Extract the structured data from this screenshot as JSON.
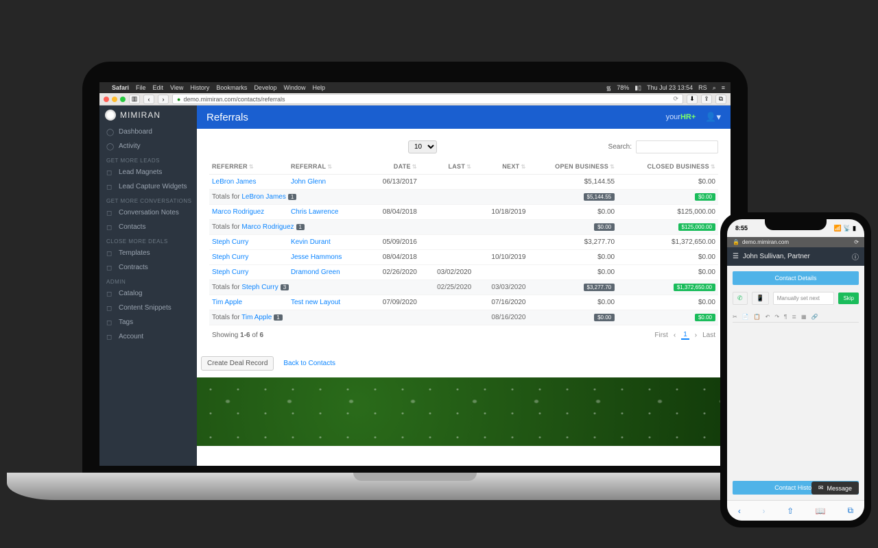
{
  "menubar": {
    "app": "Safari",
    "menus": [
      "File",
      "Edit",
      "View",
      "History",
      "Bookmarks",
      "Develop",
      "Window",
      "Help"
    ],
    "battery": "78%",
    "datetime": "Thu Jul 23 13:54",
    "user": "RS"
  },
  "browser": {
    "url": "demo.mimiran.com/contacts/referrals"
  },
  "brand": "MIMIRAN",
  "topbar_brand": {
    "prefix": "your",
    "accent": "HR+"
  },
  "sidebar": {
    "items_top": [
      {
        "label": "Dashboard",
        "icon": "speedometer-icon"
      },
      {
        "label": "Activity",
        "icon": "heart-icon"
      }
    ],
    "sections": [
      {
        "title": "GET MORE LEADS",
        "items": [
          {
            "label": "Lead Magnets",
            "icon": "magnet-icon"
          },
          {
            "label": "Lead Capture Widgets",
            "icon": "widget-icon"
          }
        ]
      },
      {
        "title": "GET MORE CONVERSATIONS",
        "items": [
          {
            "label": "Conversation Notes",
            "icon": "chat-icon"
          },
          {
            "label": "Contacts",
            "icon": "user-icon"
          }
        ]
      },
      {
        "title": "CLOSE MORE DEALS",
        "items": [
          {
            "label": "Templates",
            "icon": "template-icon"
          },
          {
            "label": "Contracts",
            "icon": "contract-icon"
          }
        ]
      },
      {
        "title": "ADMIN",
        "items": [
          {
            "label": "Catalog",
            "icon": "catalog-icon"
          },
          {
            "label": "Content Snippets",
            "icon": "snippet-icon"
          },
          {
            "label": "Tags",
            "icon": "tag-icon"
          },
          {
            "label": "Account",
            "icon": "account-icon"
          }
        ]
      }
    ]
  },
  "page": {
    "title": "Referrals",
    "page_size": "10",
    "search_label": "Search:",
    "search_value": "",
    "columns": [
      "REFERRER",
      "REFERRAL",
      "DATE",
      "LAST",
      "NEXT",
      "OPEN BUSINESS",
      "CLOSED BUSINESS"
    ],
    "entries": [
      {
        "type": "row",
        "referrer": "LeBron James",
        "referral": "John Glenn",
        "date": "06/13/2017",
        "last": "",
        "next": "",
        "open": "$5,144.55",
        "closed": "$0.00"
      },
      {
        "type": "totals",
        "label_prefix": "Totals for ",
        "name": "LeBron James",
        "count": "1",
        "open": "$5,144.55",
        "open_style": "dark",
        "closed": "$0.00",
        "closed_style": "grn"
      },
      {
        "type": "row",
        "referrer": "Marco Rodriguez",
        "referral": "Chris Lawrence",
        "date": "08/04/2018",
        "last": "",
        "next": "10/18/2019",
        "open": "$0.00",
        "closed": "$125,000.00"
      },
      {
        "type": "totals",
        "label_prefix": "Totals for ",
        "name": "Marco Rodriguez",
        "count": "1",
        "open": "$0.00",
        "open_style": "dark",
        "closed": "$125,000.00",
        "closed_style": "grn"
      },
      {
        "type": "row",
        "referrer": "Steph Curry",
        "referral": "Kevin Durant",
        "date": "05/09/2016",
        "last": "",
        "next": "",
        "open": "$3,277.70",
        "closed": "$1,372,650.00"
      },
      {
        "type": "row",
        "referrer": "Steph Curry",
        "referral": "Jesse Hammons",
        "date": "08/04/2018",
        "last": "",
        "next": "10/10/2019",
        "open": "$0.00",
        "closed": "$0.00"
      },
      {
        "type": "row",
        "referrer": "Steph Curry",
        "referral": "Dramond Green",
        "date": "02/26/2020",
        "last": "03/02/2020",
        "next": "",
        "open": "$0.00",
        "closed": "$0.00"
      },
      {
        "type": "totals",
        "label_prefix": "Totals for ",
        "name": "Steph Curry",
        "count": "3",
        "last": "02/25/2020",
        "next": "03/03/2020",
        "open": "$3,277.70",
        "open_style": "dark",
        "closed": "$1,372,650.00",
        "closed_style": "grn"
      },
      {
        "type": "row",
        "referrer": "Tim Apple",
        "referral": "Test new Layout",
        "date": "07/09/2020",
        "last": "",
        "next": "07/16/2020",
        "open": "$0.00",
        "closed": "$0.00"
      },
      {
        "type": "totals",
        "label_prefix": "Totals for ",
        "name": "Tim Apple",
        "count": "1",
        "next": "08/16/2020",
        "open": "$0.00",
        "open_style": "dark",
        "closed": "$0.00",
        "closed_style": "grn"
      }
    ],
    "showing_prefix": "Showing ",
    "showing_range": "1-6",
    "showing_mid": " of ",
    "showing_total": "6",
    "pager": {
      "first": "First",
      "last": "Last",
      "current": "1"
    },
    "create_deal": "Create Deal Record",
    "back": "Back to Contacts"
  },
  "phone": {
    "time": "8:55",
    "url": "demo.mimiran.com",
    "header": "John Sullivan, Partner",
    "contact_details": "Contact Details",
    "manual": "Manually set next",
    "skip": "Skip",
    "history": "Contact History",
    "message": "Message"
  }
}
